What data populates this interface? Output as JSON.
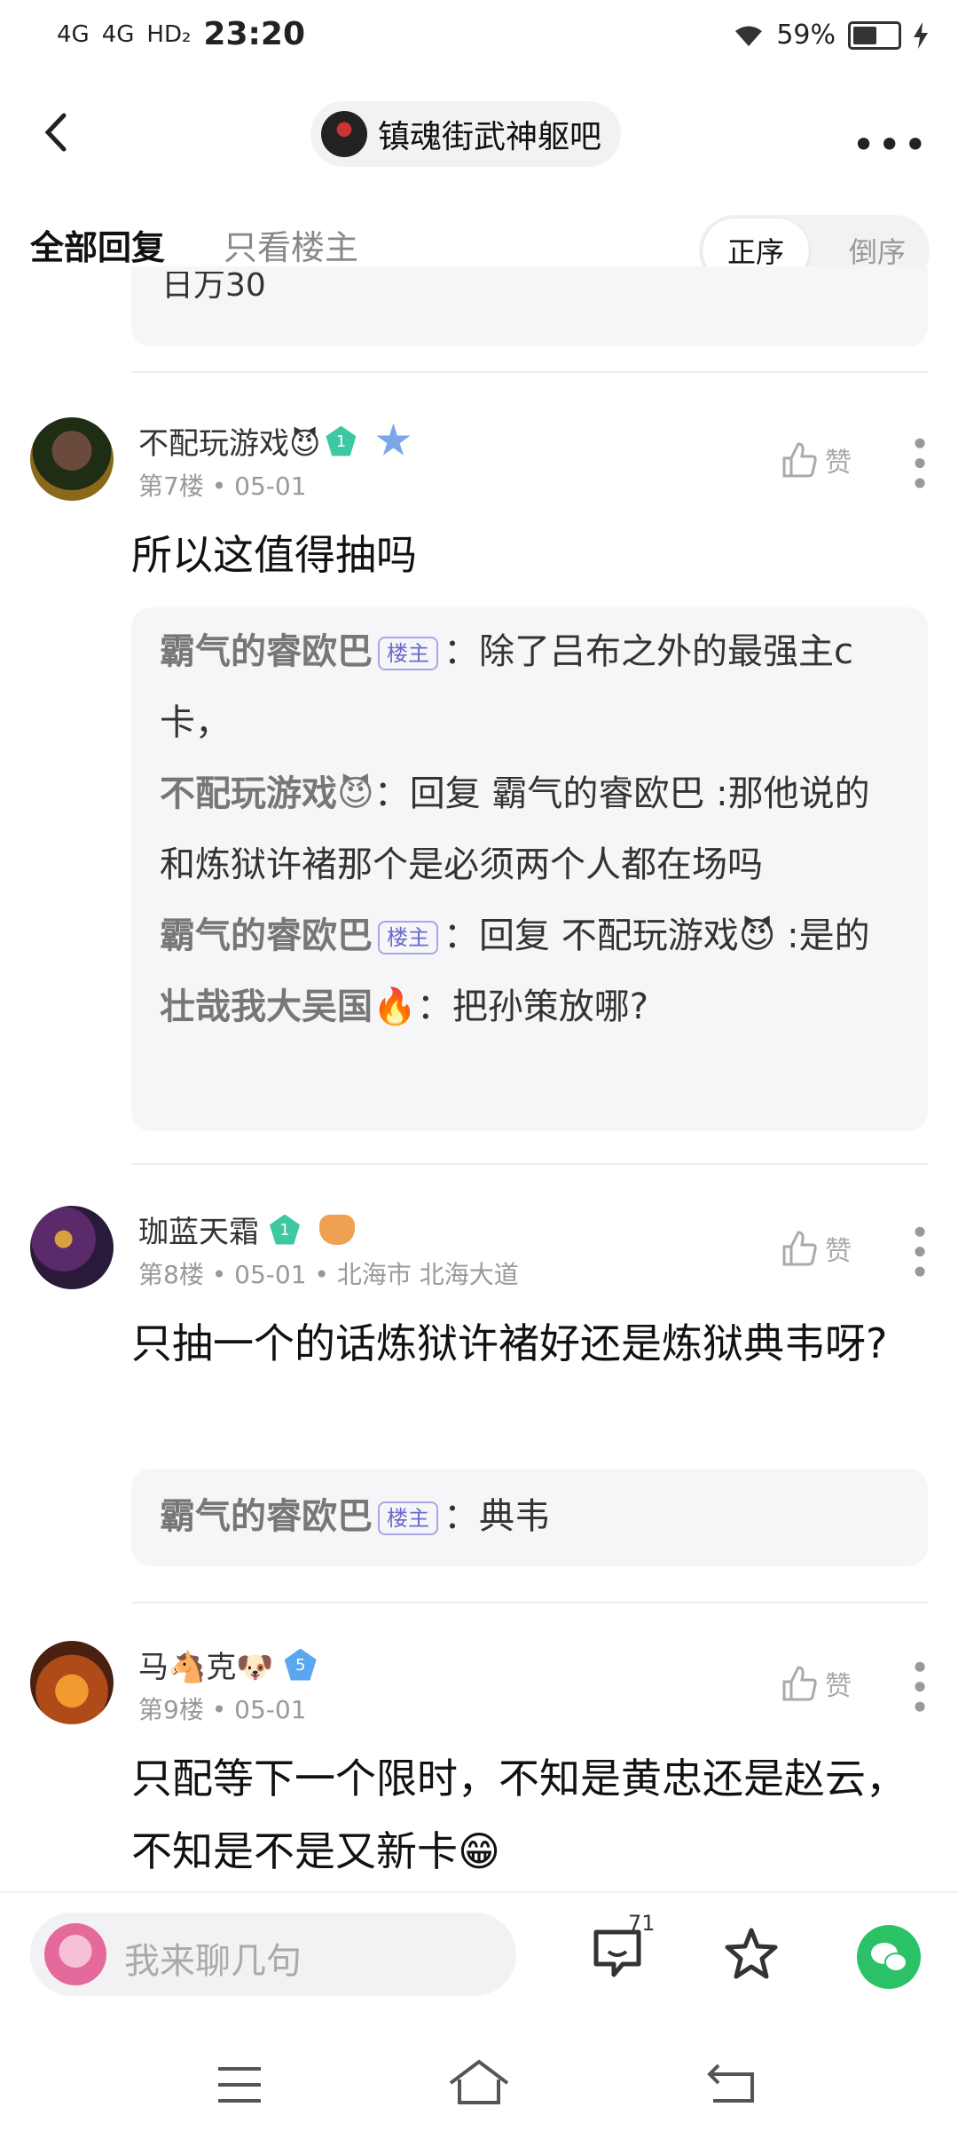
{
  "status_bar": {
    "signal1": "4G",
    "signal2": "4G",
    "hd": "HD₂",
    "time": "23:20",
    "battery_percent": "59%",
    "battery_level": 0.59
  },
  "header": {
    "forum_name": "镇魂街武神躯吧",
    "more_label": "•••"
  },
  "tabs": {
    "all": "全部回复",
    "op_only": "只看楼主",
    "sort_asc": "正序",
    "sort_desc": "倒序"
  },
  "remnant_text": "日万30",
  "posts": [
    {
      "username": "不配玩游戏😈",
      "level": "1",
      "floor": "第7楼",
      "date": "05-01",
      "location": "",
      "like_label": "赞",
      "content": "所以这值得抽吗",
      "replies": [
        {
          "name": "霸气的睿欧巴",
          "is_op": true,
          "text": "除了吕布之外的最强主c卡，"
        },
        {
          "name": "不配玩游戏😈",
          "is_op": false,
          "text": "回复 霸气的睿欧巴 :那他说的和炼狱许褚那个是必须两个人都在场吗"
        },
        {
          "name": "霸气的睿欧巴",
          "is_op": true,
          "text": "回复 不配玩游戏😈 :是的"
        },
        {
          "name": "壮哉我大吴国🔥",
          "is_op": false,
          "text": "把孙策放哪?"
        }
      ]
    },
    {
      "username": "珈蓝天霜",
      "level": "1",
      "floor": "第8楼",
      "date": "05-01",
      "location": "北海市 北海大道",
      "like_label": "赞",
      "content": "只抽一个的话炼狱许褚好还是炼狱典韦呀?",
      "replies": [
        {
          "name": "霸气的睿欧巴",
          "is_op": true,
          "text": "典韦"
        }
      ]
    },
    {
      "username": "马🐴克🐶",
      "level": "5",
      "floor": "第9楼",
      "date": "05-01",
      "location": "",
      "like_label": "赞",
      "content": "只配等下一个限时，不知是黄忠还是赵云，不知是不是又新卡😁",
      "replies": []
    }
  ],
  "op_tag": "楼主",
  "colon": "：",
  "bottom_bar": {
    "input_placeholder": "我来聊几句",
    "comment_count": "71"
  },
  "icons": {
    "back": "chevron-left-icon",
    "like": "thumbs-up-icon",
    "comment": "comment-icon",
    "favorite": "star-icon",
    "share": "wechat-icon",
    "nav_menu": "menu-icon",
    "nav_home": "home-icon",
    "nav_back": "back-icon"
  },
  "colors": {
    "accent_green": "#2bc167",
    "op_tag": "#6a6ad0"
  }
}
